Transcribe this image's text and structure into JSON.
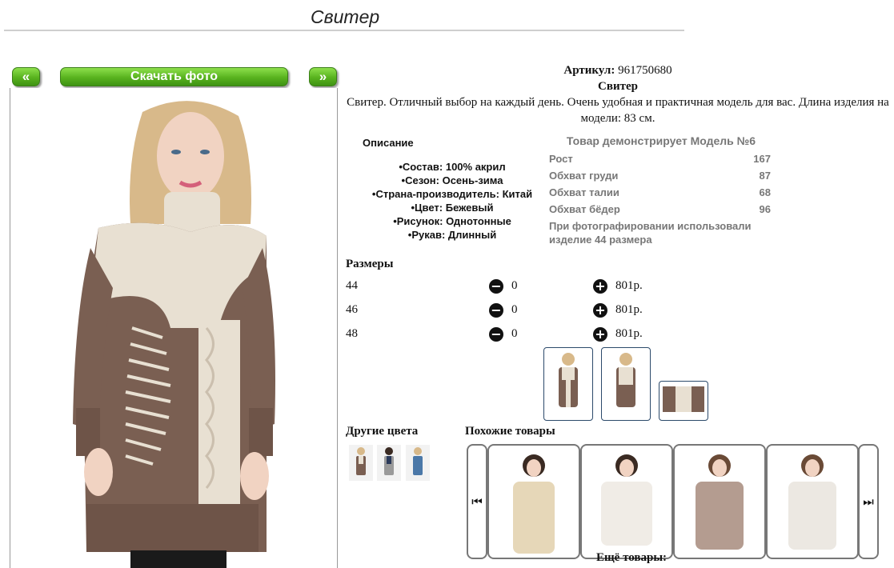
{
  "page": {
    "title": "Свитер"
  },
  "gallery": {
    "prev_label": "«",
    "download_label": "Скачать фото",
    "next_label": "»"
  },
  "product": {
    "article_label": "Артикул:",
    "article_value": "961750680",
    "name": "Свитер",
    "summary": "Свитер. Отличный выбор на каждый день. Очень удобная и практичная модель для вас. Длина изделия на модели: 83 см."
  },
  "description": {
    "header": "Описание",
    "items": [
      "Состав: 100% акрил",
      "Сезон: Осень-зима",
      "Страна-производитель: Китай",
      "Цвет: Бежевый",
      "Рисунок: Однотонные",
      "Рукав: Длинный"
    ]
  },
  "model": {
    "header": "Товар демонстрирует Модель №6",
    "rows": [
      {
        "label": "Рост",
        "value": "167"
      },
      {
        "label": "Обхват груди",
        "value": "87"
      },
      {
        "label": "Обхват талии",
        "value": "68"
      },
      {
        "label": "Обхват бёдер",
        "value": "96"
      }
    ],
    "note": "При фотографировании использовали изделие 44 размера"
  },
  "sizes": {
    "header": "Размеры",
    "rows": [
      {
        "size": "44",
        "qty": "0",
        "price": "801р."
      },
      {
        "size": "46",
        "qty": "0",
        "price": "801р."
      },
      {
        "size": "48",
        "qty": "0",
        "price": "801р."
      }
    ]
  },
  "other_colors": {
    "header": "Другие цвета"
  },
  "similar": {
    "header": "Похожие товары",
    "more_label": "Ещё товары:"
  },
  "colors": {
    "brown": "#7a5f52",
    "cream": "#e8e0d2",
    "green": "#58b21e",
    "thumb_border": "#2c4a6b"
  },
  "icons": {
    "minus": "minus-circle-icon",
    "plus": "plus-circle-icon",
    "prev": "skip-back-icon",
    "next": "skip-forward-icon"
  }
}
